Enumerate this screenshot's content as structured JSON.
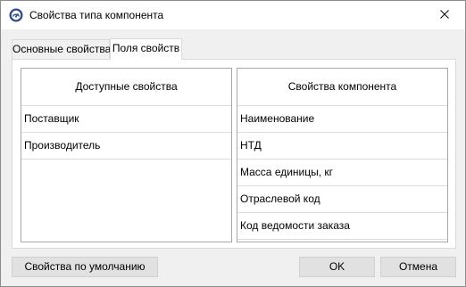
{
  "window": {
    "title": "Свойства типа компонента",
    "close_icon": "close-icon",
    "app_icon": "app-icon"
  },
  "tabs": [
    {
      "label": "Основные свойства",
      "active": false
    },
    {
      "label": "Поля свойств",
      "active": true
    }
  ],
  "available": {
    "header": "Доступные свойства",
    "items": [
      "Поставщик",
      "Производитель"
    ]
  },
  "component": {
    "header": "Свойства компонента",
    "items": [
      "Наименование",
      "НТД",
      "Масса единицы, кг",
      "Отраслевой код",
      "Код ведомости заказа"
    ]
  },
  "buttons": {
    "default_label": "Свойства по умолчанию",
    "ok_label": "OK",
    "cancel_label": "Отмена"
  }
}
